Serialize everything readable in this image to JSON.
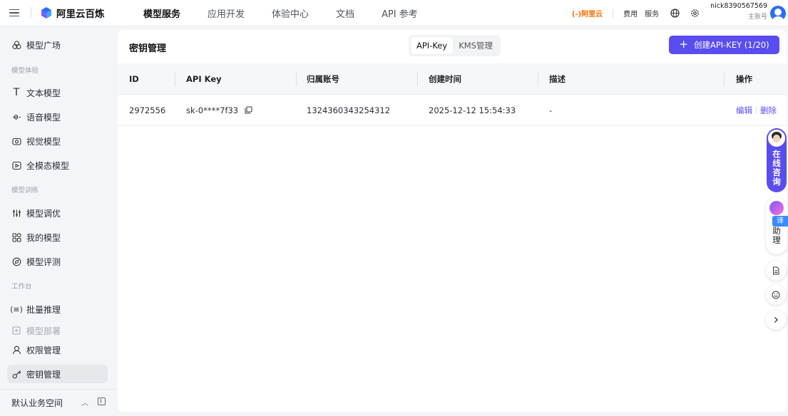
{
  "topbar": {
    "brand": "阿里云百炼",
    "nav": [
      "模型服务",
      "应用开发",
      "体验中心",
      "文档",
      "API 参考"
    ],
    "active_nav": "模型服务",
    "aliyun_logo": "(-)阿里云",
    "links": [
      "费用",
      "服务"
    ],
    "account_name": "nick8390567569",
    "account_type": "主账号"
  },
  "sidebar": {
    "items": [
      {
        "label": "模型广场",
        "icon": "model-square-icon"
      },
      {
        "group": "模型体验"
      },
      {
        "label": "文本模型",
        "icon": "text-model-icon"
      },
      {
        "label": "语音模型",
        "icon": "voice-model-icon"
      },
      {
        "label": "视觉模型",
        "icon": "vision-model-icon"
      },
      {
        "label": "全模态模型",
        "icon": "omni-model-icon"
      },
      {
        "group": "模型训练"
      },
      {
        "label": "模型调优",
        "icon": "tuning-icon"
      },
      {
        "label": "我的模型",
        "icon": "my-models-icon"
      },
      {
        "label": "模型评测",
        "icon": "evaluation-icon"
      },
      {
        "group": "工作台"
      },
      {
        "label": "批量推理",
        "icon": "batch-inference-icon"
      },
      {
        "label": "模型部署",
        "icon": "deploy-icon"
      },
      {
        "label": "权限管理",
        "icon": "permission-icon"
      },
      {
        "label": "密钥管理",
        "icon": "key-icon"
      }
    ],
    "workspace": "默认业务空间"
  },
  "main": {
    "title": "密钥管理",
    "tabs": [
      "API-Key",
      "KMS管理"
    ],
    "active_tab": "API-Key",
    "create_button": "创建API-KEY (1/20)",
    "columns": [
      "ID",
      "API Key",
      "归属账号",
      "创建时间",
      "描述",
      "操作"
    ],
    "rows": [
      {
        "id": "2972556",
        "api_key": "sk-0****7f33",
        "account": "1324360343254312",
        "created": "2025-12-12 15:54:33",
        "description": "-",
        "actions": [
          "编辑",
          "删除"
        ]
      }
    ]
  },
  "floating": {
    "consult": "在线咨询",
    "assistant_tag": "译",
    "assistant": "助理"
  },
  "colors": {
    "accent": "#5a4df0",
    "aliyun_orange": "#ff6a00"
  }
}
